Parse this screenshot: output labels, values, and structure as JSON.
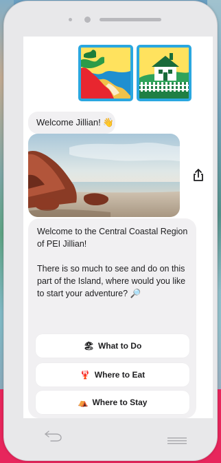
{
  "chat": {
    "welcome_text": "Welcome Jillian!",
    "welcome_emoji": "👋",
    "message_paragraph_1": "Welcome to the Central Coastal Region of PEI Jillian!",
    "message_paragraph_2": "There is so much to see and do on this part of the Island, where would you like to start your adventure? 🔎"
  },
  "options": [
    {
      "emoji": "🏖",
      "label": "What to Do"
    },
    {
      "emoji": "🦞",
      "label": "Where to Eat"
    },
    {
      "emoji": "⛺",
      "label": "Where to Stay"
    }
  ],
  "icons": {
    "share": "share-icon",
    "back": "back-icon",
    "menu": "menu-icon"
  },
  "colors": {
    "brand_accent": "#e7265c",
    "logo_border": "#2aa7e0",
    "bubble": "#f1f0f2"
  }
}
